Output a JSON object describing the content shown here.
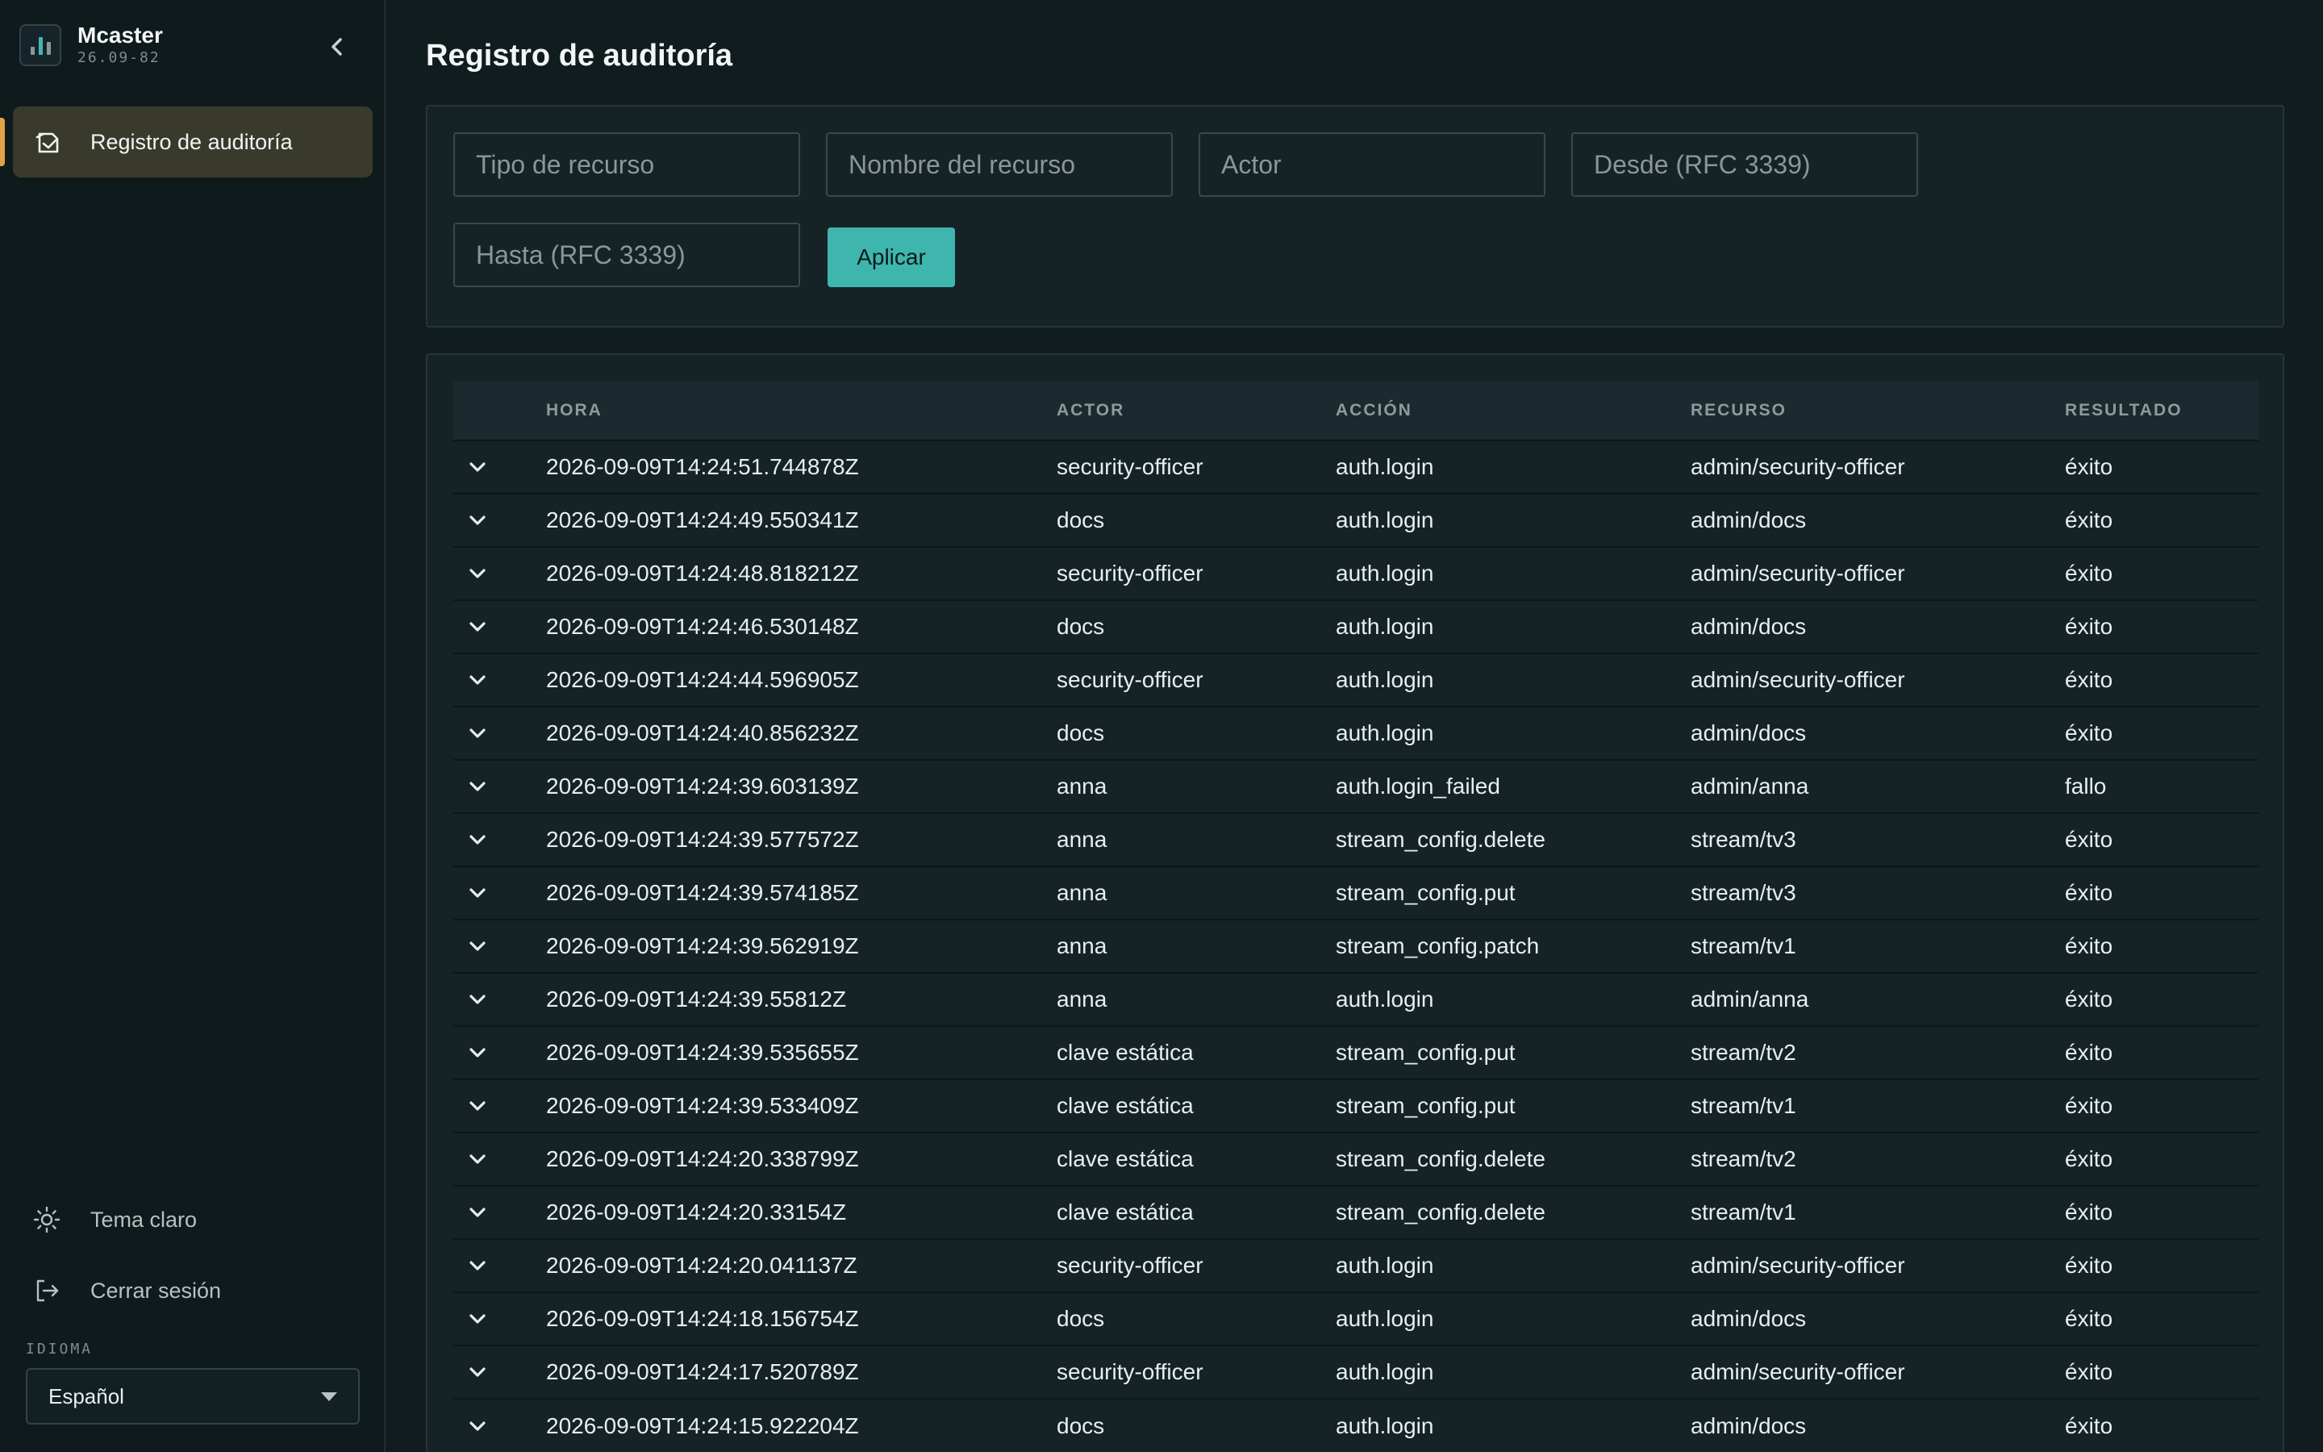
{
  "app": {
    "name": "Mcaster",
    "version": "26.09-82"
  },
  "sidebar": {
    "nav_items": [
      {
        "label": "Registro de auditoría",
        "icon": "audit-log-icon",
        "active": true
      }
    ],
    "theme_toggle_label": "Tema claro",
    "logout_label": "Cerrar sesión",
    "language_label": "IDIOMA",
    "language_value": "Español"
  },
  "page": {
    "title": "Registro de auditoría"
  },
  "filters": {
    "resource_type_placeholder": "Tipo de recurso",
    "resource_name_placeholder": "Nombre del recurso",
    "actor_placeholder": "Actor",
    "from_placeholder": "Desde (RFC 3339)",
    "to_placeholder": "Hasta (RFC 3339)",
    "apply_label": "Aplicar"
  },
  "table": {
    "headers": {
      "time": "HORA",
      "actor": "ACTOR",
      "action": "ACCIÓN",
      "resource": "RECURSO",
      "result": "RESULTADO"
    },
    "rows": [
      {
        "time": "2026-09-09T14:24:51.744878Z",
        "actor": "security-officer",
        "action": "auth.login",
        "resource": "admin/security-officer",
        "result": "éxito"
      },
      {
        "time": "2026-09-09T14:24:49.550341Z",
        "actor": "docs",
        "action": "auth.login",
        "resource": "admin/docs",
        "result": "éxito"
      },
      {
        "time": "2026-09-09T14:24:48.818212Z",
        "actor": "security-officer",
        "action": "auth.login",
        "resource": "admin/security-officer",
        "result": "éxito"
      },
      {
        "time": "2026-09-09T14:24:46.530148Z",
        "actor": "docs",
        "action": "auth.login",
        "resource": "admin/docs",
        "result": "éxito"
      },
      {
        "time": "2026-09-09T14:24:44.596905Z",
        "actor": "security-officer",
        "action": "auth.login",
        "resource": "admin/security-officer",
        "result": "éxito"
      },
      {
        "time": "2026-09-09T14:24:40.856232Z",
        "actor": "docs",
        "action": "auth.login",
        "resource": "admin/docs",
        "result": "éxito"
      },
      {
        "time": "2026-09-09T14:24:39.603139Z",
        "actor": "anna",
        "action": "auth.login_failed",
        "resource": "admin/anna",
        "result": "fallo"
      },
      {
        "time": "2026-09-09T14:24:39.577572Z",
        "actor": "anna",
        "action": "stream_config.delete",
        "resource": "stream/tv3",
        "result": "éxito"
      },
      {
        "time": "2026-09-09T14:24:39.574185Z",
        "actor": "anna",
        "action": "stream_config.put",
        "resource": "stream/tv3",
        "result": "éxito"
      },
      {
        "time": "2026-09-09T14:24:39.562919Z",
        "actor": "anna",
        "action": "stream_config.patch",
        "resource": "stream/tv1",
        "result": "éxito"
      },
      {
        "time": "2026-09-09T14:24:39.55812Z",
        "actor": "anna",
        "action": "auth.login",
        "resource": "admin/anna",
        "result": "éxito"
      },
      {
        "time": "2026-09-09T14:24:39.535655Z",
        "actor": "clave estática",
        "action": "stream_config.put",
        "resource": "stream/tv2",
        "result": "éxito"
      },
      {
        "time": "2026-09-09T14:24:39.533409Z",
        "actor": "clave estática",
        "action": "stream_config.put",
        "resource": "stream/tv1",
        "result": "éxito"
      },
      {
        "time": "2026-09-09T14:24:20.338799Z",
        "actor": "clave estática",
        "action": "stream_config.delete",
        "resource": "stream/tv2",
        "result": "éxito"
      },
      {
        "time": "2026-09-09T14:24:20.33154Z",
        "actor": "clave estática",
        "action": "stream_config.delete",
        "resource": "stream/tv1",
        "result": "éxito"
      },
      {
        "time": "2026-09-09T14:24:20.041137Z",
        "actor": "security-officer",
        "action": "auth.login",
        "resource": "admin/security-officer",
        "result": "éxito"
      },
      {
        "time": "2026-09-09T14:24:18.156754Z",
        "actor": "docs",
        "action": "auth.login",
        "resource": "admin/docs",
        "result": "éxito"
      },
      {
        "time": "2026-09-09T14:24:17.520789Z",
        "actor": "security-officer",
        "action": "auth.login",
        "resource": "admin/security-officer",
        "result": "éxito"
      },
      {
        "time": "2026-09-09T14:24:15.922204Z",
        "actor": "docs",
        "action": "auth.login",
        "resource": "admin/docs",
        "result": "éxito"
      }
    ]
  },
  "colors": {
    "accent": "#3fb6ad",
    "active_nav_bg": "#3a3a2c",
    "active_nav_marker": "#e0a24a",
    "background": "#111c1f"
  }
}
